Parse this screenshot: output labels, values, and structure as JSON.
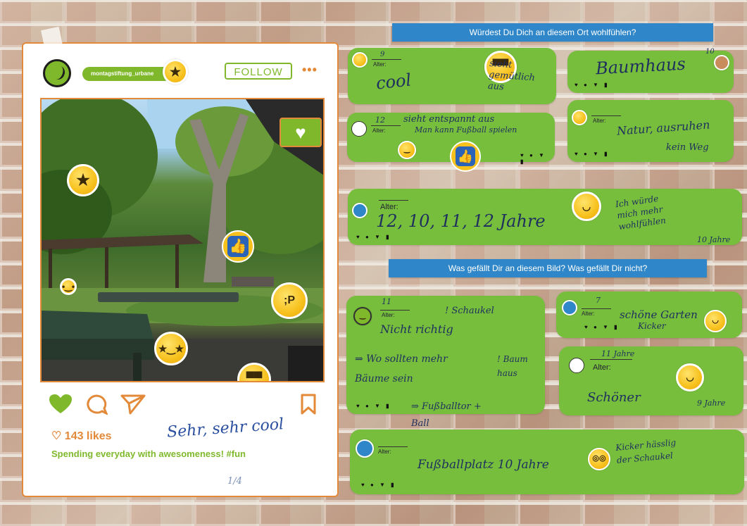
{
  "post": {
    "username": "montagstiftung_urbane",
    "follow_label": "FOLLOW",
    "more_label": "•••",
    "likes_label": "♡ 143 likes",
    "caption": "Spending everyday with awesomeness! #fun",
    "handwritten_comment": "Sehr, sehr cool",
    "handwritten_number": "1/4"
  },
  "questions": {
    "q1": "Würdest Du Dich an diesem Ort wohlfühlen?",
    "q2": "Was gefällt Dir an diesem Bild? Was gefällt Dir nicht?"
  },
  "bubble_ui": {
    "alter_label": "Alter:",
    "icons": "♥ ● ▼ ▮"
  },
  "comments": [
    {
      "id": "c1",
      "age": "9",
      "text_a": "cool",
      "text_b": "sieht gemütlich aus"
    },
    {
      "id": "c2",
      "age": "10",
      "text_a": "Baumhaus"
    },
    {
      "id": "c3",
      "age": "12",
      "text_a": "sieht entspannt aus",
      "text_b": "Man kann Fußball spielen"
    },
    {
      "id": "c4",
      "age": "",
      "text_a": "Natur, ausruhen",
      "text_b": "kein Weg"
    },
    {
      "id": "c5",
      "age": "",
      "text_a": "12, 10, 11, 12 Jahre",
      "text_b": "Ich würde mich mehr wohlfühlen",
      "text_c": "10 Jahre"
    },
    {
      "id": "c6",
      "age": "11",
      "text_a": "Nicht richtig",
      "text_b": "! Schaukel",
      "text_c": "⇒ Wo sollten mehr Bäume sein",
      "text_d": "! Baum haus",
      "text_e": "⇒ Fußballtor + Ball"
    },
    {
      "id": "c7",
      "age": "7",
      "text_a": "schöne Garten",
      "text_b": "Kicker"
    },
    {
      "id": "c8",
      "age": "11 Jahre",
      "text_a": "Schöner",
      "text_b": "9 Jahre"
    },
    {
      "id": "c9",
      "age": "",
      "text_a": "Fußballplatz 10 Jahre",
      "text_b": "Kicker hässlig der Schaukel"
    }
  ],
  "colors": {
    "accent_orange": "#e38a3a",
    "accent_green": "#7fb92b",
    "bubble_green": "#77be3c",
    "banner_blue": "#2f86c8"
  }
}
